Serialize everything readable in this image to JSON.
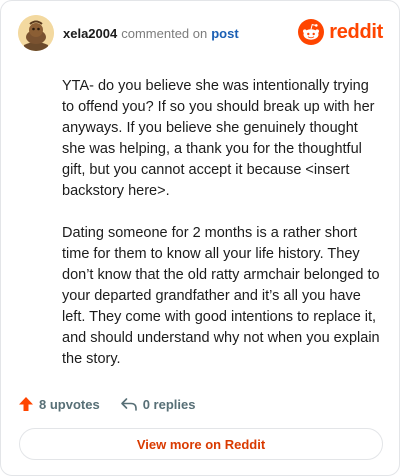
{
  "comment": {
    "username": "xela2004",
    "action_text": "commented on",
    "post_link": "post",
    "paragraphs": [
      "YTA- do you believe she was intentionally trying to offend you? If so you should break up with her anyways. If you believe she genuinely thought she was helping, a thank you for the thoughtful gift, but you cannot accept it because <insert backstory here>.",
      "Dating someone for 2 months is a rather short time for them to know all your life history. They don’t know that the old ratty armchair belonged to your departed grandfather and it’s all you have left. They come with good intentions to replace it, and should understand why not when you explain the story."
    ]
  },
  "brand": {
    "name": "reddit",
    "icon": "reddit-logo-icon",
    "color": "#ff4500"
  },
  "actions": {
    "upvotes_label": "8 upvotes",
    "replies_label": "0 replies",
    "upvote_icon": "upvote-arrow-icon",
    "reply_icon": "reply-arrow-icon",
    "upvote_color": "#ff4500"
  },
  "footer": {
    "view_more_label": "View more on Reddit",
    "accent": "#d93a00"
  }
}
